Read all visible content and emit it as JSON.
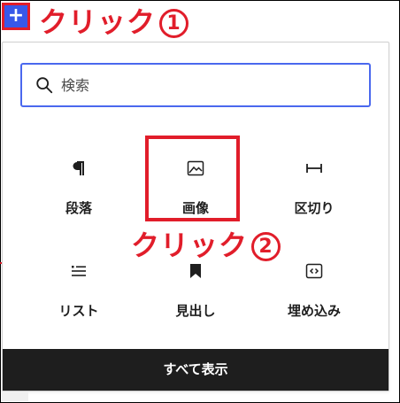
{
  "inserter_button": {
    "label": "+"
  },
  "annotations": {
    "step1_text": "クリック",
    "step1_number": "1",
    "step2_text": "クリック",
    "step2_number": "2"
  },
  "search": {
    "placeholder": "検索",
    "value": ""
  },
  "blocks": [
    {
      "label": "段落",
      "icon": "paragraph-icon"
    },
    {
      "label": "画像",
      "icon": "image-icon"
    },
    {
      "label": "区切り",
      "icon": "separator-icon"
    },
    {
      "label": "リスト",
      "icon": "list-icon"
    },
    {
      "label": "見出し",
      "icon": "bookmark-icon"
    },
    {
      "label": "埋め込み",
      "icon": "embed-icon"
    }
  ],
  "footer": {
    "show_all_label": "すべて表示"
  },
  "colors": {
    "accent": "#3858e9",
    "annotation_red": "#e11d2a",
    "footer_bg": "#1e1e1e"
  }
}
